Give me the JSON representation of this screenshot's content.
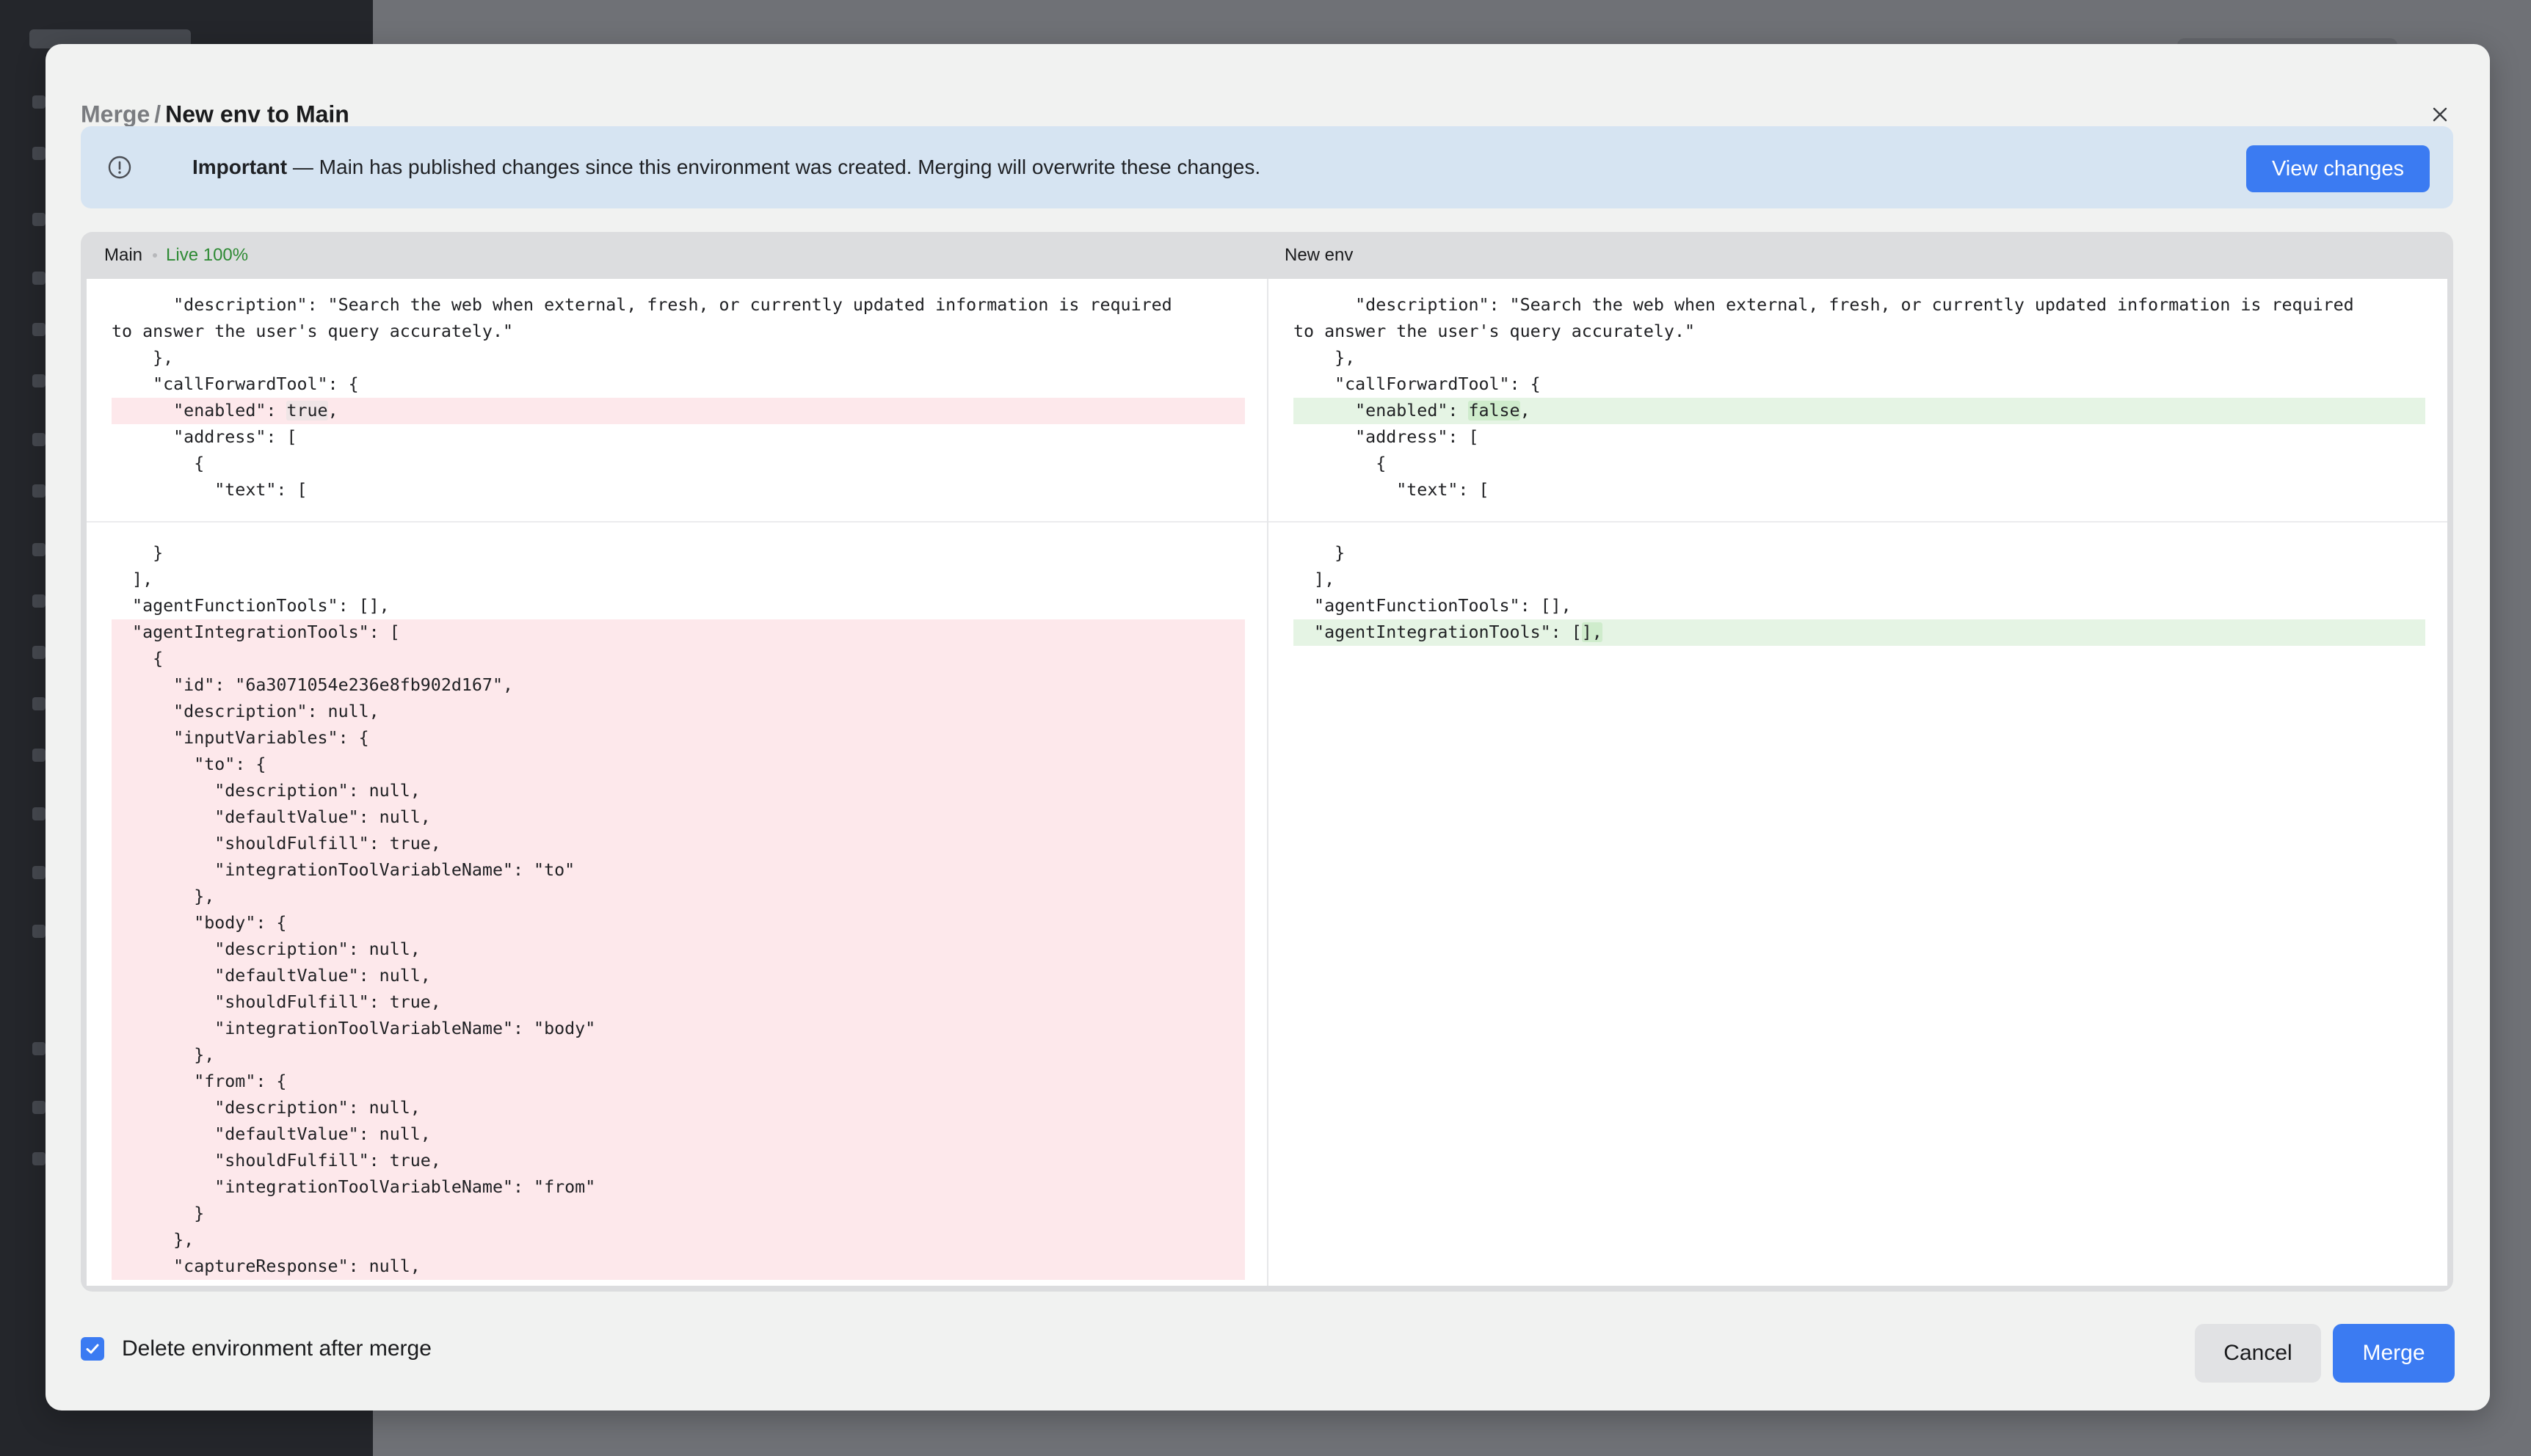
{
  "modal": {
    "breadcrumb_parent": "Merge",
    "separator": "/",
    "title": "New env to Main"
  },
  "banner": {
    "label": "Important",
    "message": " — Main has published changes since this environment was created. Merging will overwrite these changes.",
    "button": "View changes"
  },
  "diff": {
    "left_header": "Main",
    "left_status": "Live 100%",
    "right_header": "New env",
    "left_hunks": [
      [
        {
          "pre": "      \"description\": \"Search the web when external, fresh, or currently updated information is required",
          "hl": "",
          "post": "",
          "type": "ctx"
        },
        {
          "pre": "to answer the user's query accurately.\"",
          "hl": "",
          "post": "",
          "type": "ctx"
        },
        {
          "pre": "    },",
          "hl": "",
          "post": "",
          "type": "ctx"
        },
        {
          "pre": "    \"callForwardTool\": {",
          "hl": "",
          "post": "",
          "type": "ctx"
        },
        {
          "pre": "      \"enabled\": ",
          "hl": "true",
          "post": ",",
          "type": "del"
        },
        {
          "pre": "      \"address\": [",
          "hl": "",
          "post": "",
          "type": "ctx"
        },
        {
          "pre": "        {",
          "hl": "",
          "post": "",
          "type": "ctx"
        },
        {
          "pre": "          \"text\": [",
          "hl": "",
          "post": "",
          "type": "ctx"
        }
      ],
      [
        {
          "pre": "    }",
          "hl": "",
          "post": "",
          "type": "ctx"
        },
        {
          "pre": "  ],",
          "hl": "",
          "post": "",
          "type": "ctx"
        },
        {
          "pre": "  \"agentFunctionTools\": [],",
          "hl": "",
          "post": "",
          "type": "ctx"
        },
        {
          "pre": "  \"agentIntegrationTools\": [",
          "hl": "",
          "post": "",
          "type": "del"
        },
        {
          "pre": "    {",
          "hl": "",
          "post": "",
          "type": "del"
        },
        {
          "pre": "      \"id\": \"6a3071054e236e8fb902d167\",",
          "hl": "",
          "post": "",
          "type": "del"
        },
        {
          "pre": "      \"description\": null,",
          "hl": "",
          "post": "",
          "type": "del"
        },
        {
          "pre": "      \"inputVariables\": {",
          "hl": "",
          "post": "",
          "type": "del"
        },
        {
          "pre": "        \"to\": {",
          "hl": "",
          "post": "",
          "type": "del"
        },
        {
          "pre": "          \"description\": null,",
          "hl": "",
          "post": "",
          "type": "del"
        },
        {
          "pre": "          \"defaultValue\": null,",
          "hl": "",
          "post": "",
          "type": "del"
        },
        {
          "pre": "          \"shouldFulfill\": true,",
          "hl": "",
          "post": "",
          "type": "del"
        },
        {
          "pre": "          \"integrationToolVariableName\": \"to\"",
          "hl": "",
          "post": "",
          "type": "del"
        },
        {
          "pre": "        },",
          "hl": "",
          "post": "",
          "type": "del"
        },
        {
          "pre": "        \"body\": {",
          "hl": "",
          "post": "",
          "type": "del"
        },
        {
          "pre": "          \"description\": null,",
          "hl": "",
          "post": "",
          "type": "del"
        },
        {
          "pre": "          \"defaultValue\": null,",
          "hl": "",
          "post": "",
          "type": "del"
        },
        {
          "pre": "          \"shouldFulfill\": true,",
          "hl": "",
          "post": "",
          "type": "del"
        },
        {
          "pre": "          \"integrationToolVariableName\": \"body\"",
          "hl": "",
          "post": "",
          "type": "del"
        },
        {
          "pre": "        },",
          "hl": "",
          "post": "",
          "type": "del"
        },
        {
          "pre": "        \"from\": {",
          "hl": "",
          "post": "",
          "type": "del"
        },
        {
          "pre": "          \"description\": null,",
          "hl": "",
          "post": "",
          "type": "del"
        },
        {
          "pre": "          \"defaultValue\": null,",
          "hl": "",
          "post": "",
          "type": "del"
        },
        {
          "pre": "          \"shouldFulfill\": true,",
          "hl": "",
          "post": "",
          "type": "del"
        },
        {
          "pre": "          \"integrationToolVariableName\": \"from\"",
          "hl": "",
          "post": "",
          "type": "del"
        },
        {
          "pre": "        }",
          "hl": "",
          "post": "",
          "type": "del"
        },
        {
          "pre": "      },",
          "hl": "",
          "post": "",
          "type": "del"
        },
        {
          "pre": "      \"captureResponse\": null,",
          "hl": "",
          "post": "",
          "type": "del"
        }
      ]
    ],
    "right_hunks": [
      [
        {
          "pre": "      \"description\": \"Search the web when external, fresh, or currently updated information is required",
          "hl": "",
          "post": "",
          "type": "ctx"
        },
        {
          "pre": "to answer the user's query accurately.\"",
          "hl": "",
          "post": "",
          "type": "ctx"
        },
        {
          "pre": "    },",
          "hl": "",
          "post": "",
          "type": "ctx"
        },
        {
          "pre": "    \"callForwardTool\": {",
          "hl": "",
          "post": "",
          "type": "ctx"
        },
        {
          "pre": "      \"enabled\": ",
          "hl": "false",
          "post": ",",
          "type": "add"
        },
        {
          "pre": "      \"address\": [",
          "hl": "",
          "post": "",
          "type": "ctx"
        },
        {
          "pre": "        {",
          "hl": "",
          "post": "",
          "type": "ctx"
        },
        {
          "pre": "          \"text\": [",
          "hl": "",
          "post": "",
          "type": "ctx"
        }
      ],
      [
        {
          "pre": "    }",
          "hl": "",
          "post": "",
          "type": "ctx"
        },
        {
          "pre": "  ],",
          "hl": "",
          "post": "",
          "type": "ctx"
        },
        {
          "pre": "  \"agentFunctionTools\": [],",
          "hl": "",
          "post": "",
          "type": "ctx"
        },
        {
          "pre": "  \"agentIntegrationTools\": [",
          "hl": "],",
          "post": "",
          "type": "add"
        }
      ]
    ]
  },
  "footer": {
    "checkbox_label": "Delete environment after merge",
    "checkbox_checked": true,
    "cancel": "Cancel",
    "merge": "Merge"
  },
  "colors": {
    "accent": "#3b7bf2",
    "deleted_line": "#fde8eb",
    "added_line": "#e5f4e4",
    "live_status": "#2e8a34",
    "banner_bg": "#d6e4f2"
  },
  "icons": {
    "close": "close-icon",
    "info": "info-circle-icon",
    "checkbox": "checkmark-icon"
  }
}
